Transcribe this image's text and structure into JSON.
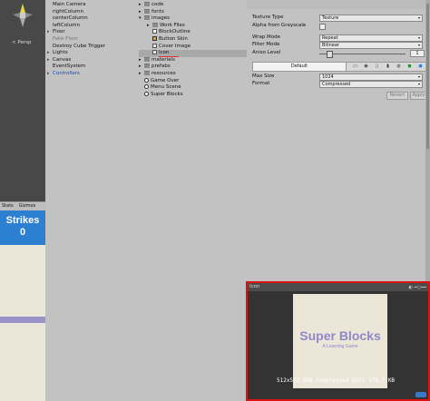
{
  "scene": {
    "persp_label": "< Persp"
  },
  "game": {
    "tabs": [
      "Stats",
      "Gizmos"
    ],
    "strikes_label": "Strikes",
    "strikes_value": "0"
  },
  "hierarchy": {
    "items": [
      {
        "label": "Main Camera",
        "style": "normal",
        "arrow": ""
      },
      {
        "label": "rightColumn",
        "style": "normal",
        "arrow": ""
      },
      {
        "label": "centerColumn",
        "style": "normal",
        "arrow": ""
      },
      {
        "label": "leftColumn",
        "style": "normal",
        "arrow": ""
      },
      {
        "label": "Floor",
        "style": "normal",
        "arrow": "▸"
      },
      {
        "label": "Fake Floor",
        "style": "dim",
        "arrow": ""
      },
      {
        "label": "Destroy Cube Trigger",
        "style": "normal",
        "arrow": ""
      },
      {
        "label": "Lights",
        "style": "normal",
        "arrow": "▸"
      },
      {
        "label": "Canvas",
        "style": "normal",
        "arrow": "▸"
      },
      {
        "label": "EventSystem",
        "style": "normal",
        "arrow": ""
      },
      {
        "label": "Controllers",
        "style": "blue",
        "arrow": "▸"
      }
    ]
  },
  "project": {
    "items": [
      {
        "label": "code",
        "kind": "folder",
        "indent": 0,
        "arrow": "▸"
      },
      {
        "label": "fonts",
        "kind": "folder",
        "indent": 0,
        "arrow": "▸"
      },
      {
        "label": "images",
        "kind": "folder",
        "indent": 0,
        "arrow": "▾"
      },
      {
        "label": "Work Files",
        "kind": "folder",
        "indent": 1,
        "arrow": "▸"
      },
      {
        "label": "BlockOutline",
        "kind": "white",
        "indent": 1,
        "arrow": ""
      },
      {
        "label": "Button Skin",
        "kind": "orange",
        "indent": 1,
        "arrow": ""
      },
      {
        "label": "Cover Image",
        "kind": "beige",
        "indent": 1,
        "arrow": ""
      },
      {
        "label": "Icon",
        "kind": "selected",
        "indent": 1,
        "arrow": ""
      },
      {
        "label": "materials",
        "kind": "folder",
        "indent": 0,
        "arrow": "▸"
      },
      {
        "label": "prefabs",
        "kind": "folder",
        "indent": 0,
        "arrow": "▸"
      },
      {
        "label": "resources",
        "kind": "folder",
        "indent": 0,
        "arrow": "▸"
      },
      {
        "label": "Game Over",
        "kind": "scene",
        "indent": 0,
        "arrow": ""
      },
      {
        "label": "Menu Scene",
        "kind": "scene",
        "indent": 0,
        "arrow": ""
      },
      {
        "label": "Super Blocks",
        "kind": "scene",
        "indent": 0,
        "arrow": ""
      }
    ]
  },
  "inspector": {
    "texture_type_label": "Texture Type",
    "texture_type_value": "Texture",
    "alpha_label": "Alpha from Grayscale",
    "alpha_checked": false,
    "wrap_mode_label": "Wrap Mode",
    "wrap_mode_value": "Repeat",
    "filter_mode_label": "Filter Mode",
    "filter_mode_value": "Bilinear",
    "aniso_label": "Aniso Level",
    "aniso_value": "1",
    "platform_default": "Default",
    "max_size_label": "Max Size",
    "max_size_value": "1024",
    "format_label": "Format",
    "format_value": "Compressed",
    "revert_label": "Revert",
    "apply_label": "Apply"
  },
  "preview": {
    "title": "Icon",
    "texture_title": "Super Blocks",
    "texture_subtitle": "A Learning Game",
    "info": "512x512  RGB Compressed DXT1  170.7 KB"
  }
}
